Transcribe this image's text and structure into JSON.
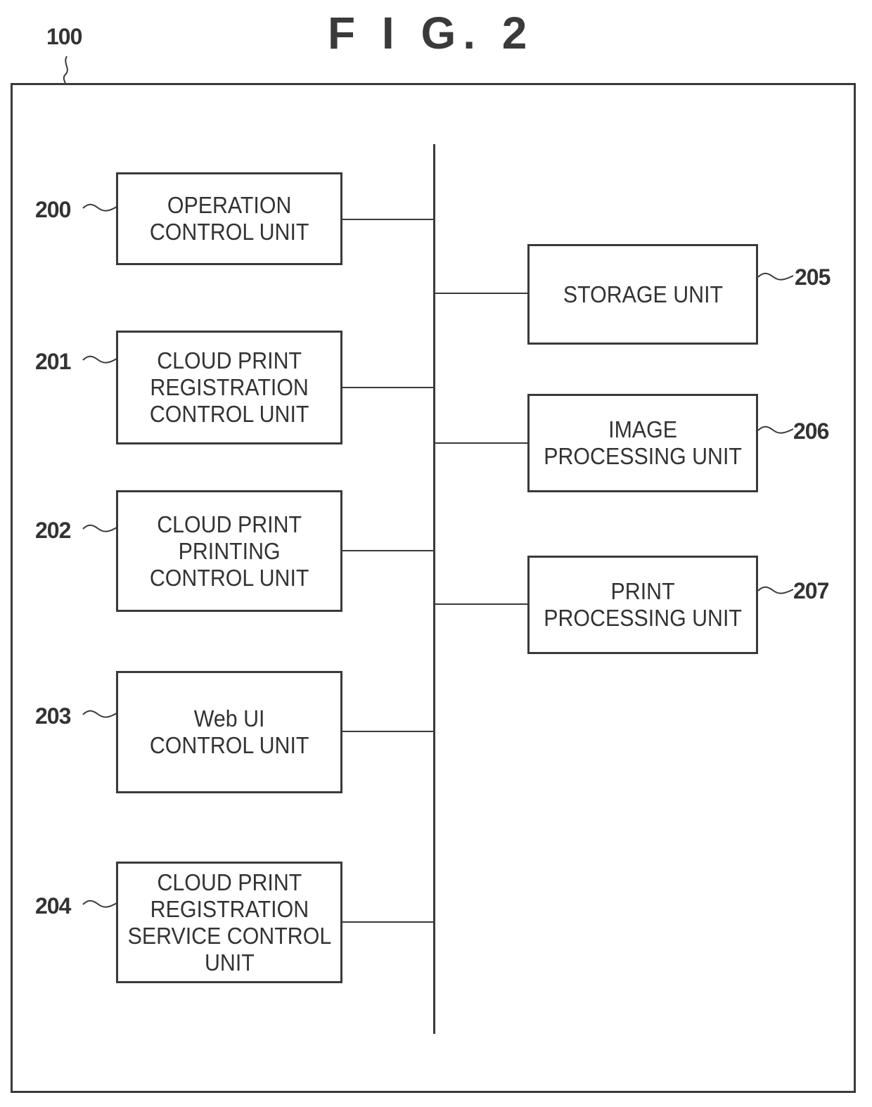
{
  "figure": {
    "title": "F I G. 2",
    "container_ref": "100"
  },
  "left_units": [
    {
      "ref": "200",
      "label": "OPERATION\nCONTROL UNIT"
    },
    {
      "ref": "201",
      "label": "CLOUD PRINT\nREGISTRATION\nCONTROL UNIT"
    },
    {
      "ref": "202",
      "label": "CLOUD PRINT\nPRINTING\nCONTROL UNIT"
    },
    {
      "ref": "203",
      "label": "Web UI\nCONTROL UNIT"
    },
    {
      "ref": "204",
      "label": "CLOUD PRINT\nREGISTRATION\nSERVICE CONTROL\nUNIT"
    }
  ],
  "right_units": [
    {
      "ref": "205",
      "label": "STORAGE UNIT"
    },
    {
      "ref": "206",
      "label": "IMAGE\nPROCESSING UNIT"
    },
    {
      "ref": "207",
      "label": "PRINT\nPROCESSING UNIT"
    }
  ]
}
